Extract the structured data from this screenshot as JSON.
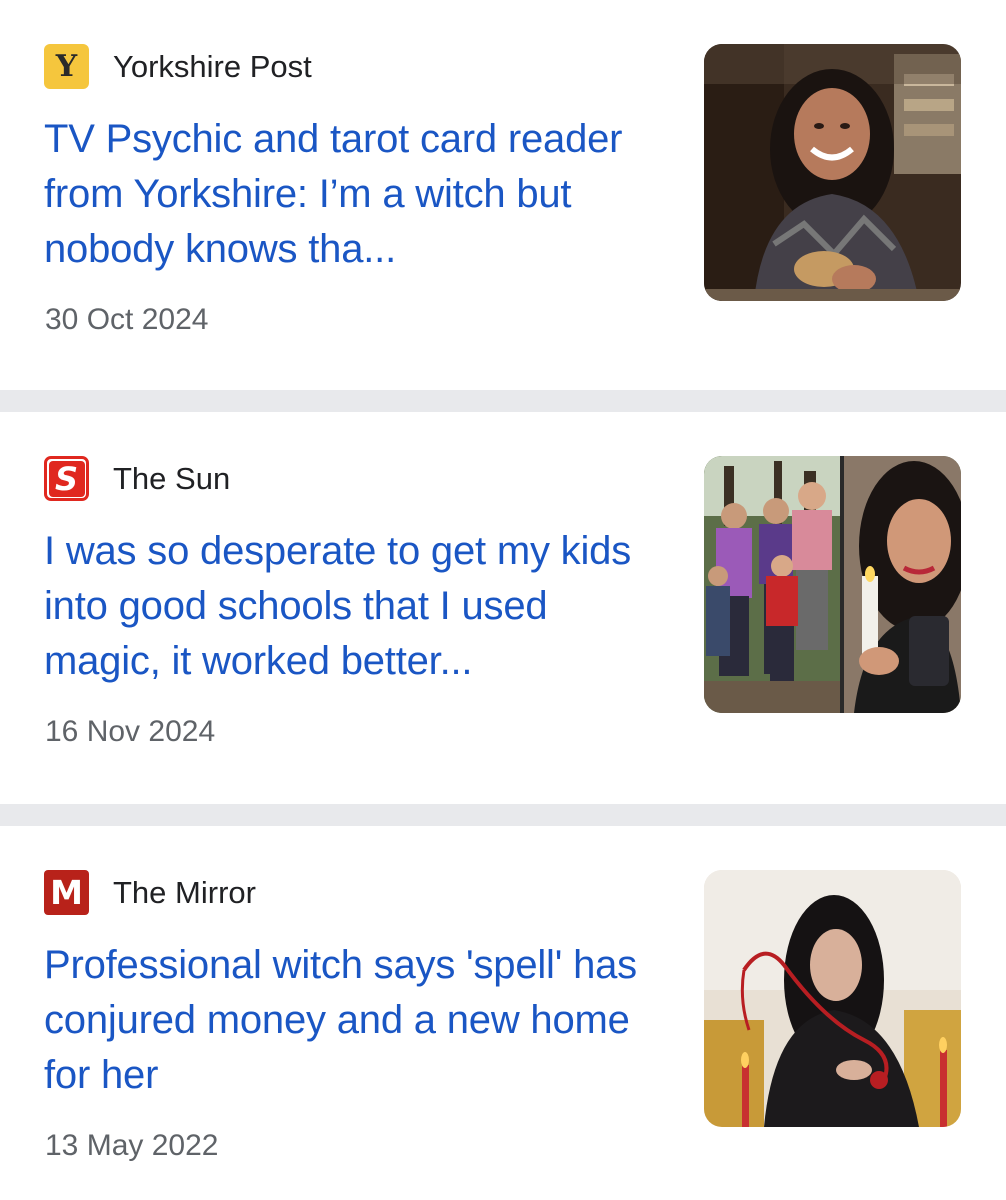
{
  "articles": [
    {
      "source": "Yorkshire Post",
      "logo_letter": "Y",
      "logo_color": "#f5c63d",
      "headline": "TV Psychic and tarot card reader from Yorkshire: I’m a witch but nobody knows tha...",
      "date": "30 Oct 2024",
      "thumbnail": "photo-woman-smiling-holding-cards"
    },
    {
      "source": "The Sun",
      "logo_letter": "S",
      "logo_color": "#e0281f",
      "headline": "I was so desperate to get my kids into good schools that I used magic, it worked better...",
      "date": "16 Nov 2024",
      "thumbnail": "photo-family-and-woman-with-candle"
    },
    {
      "source": "The Mirror",
      "logo_letter": "M",
      "logo_color": "#b8221a",
      "headline": "Professional witch says 'spell' has conjured money and a new home for her",
      "date": "13 May 2022",
      "thumbnail": "photo-woman-with-red-ribbon-and-candles"
    }
  ],
  "colors": {
    "headline": "#1a56c4",
    "date": "#5f6368",
    "divider": "#e8e9ec"
  }
}
